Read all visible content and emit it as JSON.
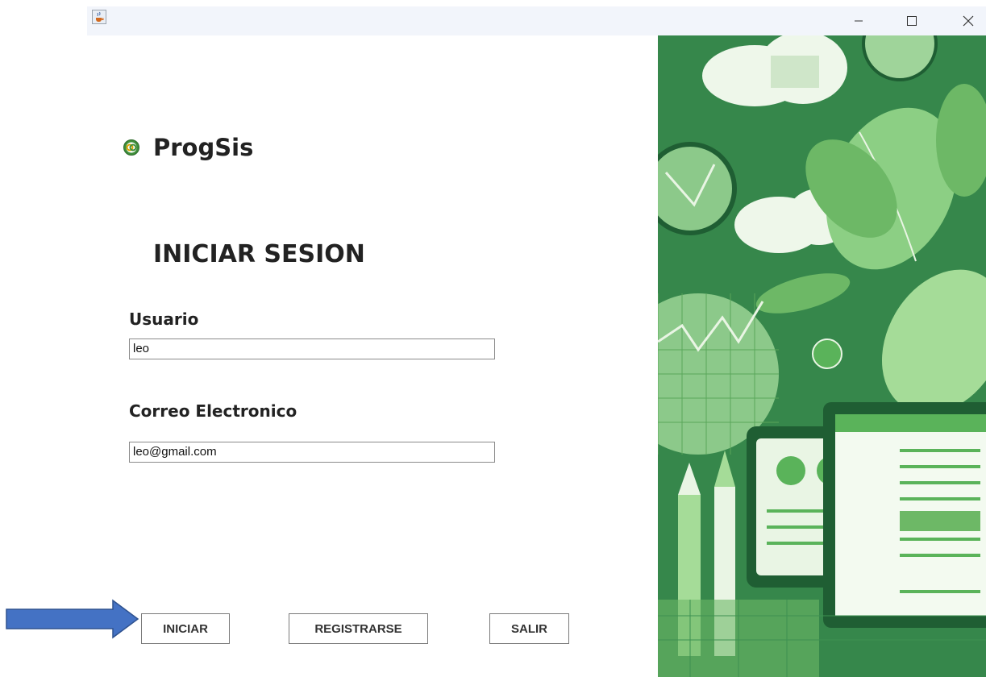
{
  "window": {
    "app_icon": "java-cup-icon",
    "controls": [
      "minimize-icon",
      "maximize-icon",
      "close-icon"
    ]
  },
  "brand": {
    "name": "ProgSis",
    "icon": "logo-rings-icon"
  },
  "form": {
    "title": "INICIAR SESION",
    "user_label": "Usuario",
    "user_value": "leo",
    "email_label": "Correo Electronico",
    "email_value": "leo@gmail.com"
  },
  "buttons": {
    "login": "INICIAR",
    "register": "REGISTRARSE",
    "exit": "SALIR"
  },
  "colors": {
    "accent_green": "#2f7d45",
    "arrow_blue": "#4472c4"
  }
}
